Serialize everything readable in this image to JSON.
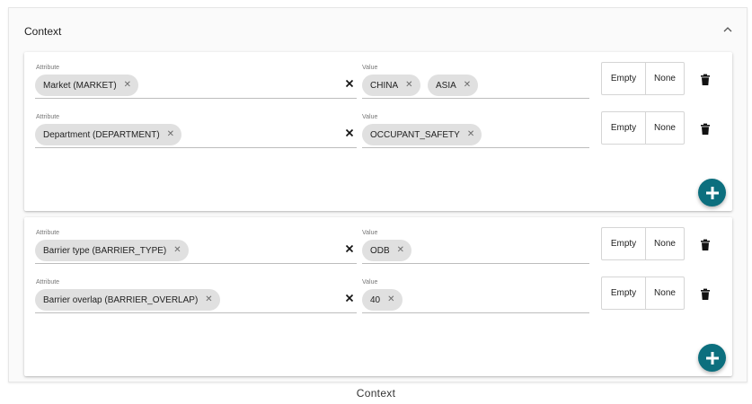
{
  "panel": {
    "title": "Context"
  },
  "groups": [
    {
      "rows": [
        {
          "attribute_label": "Attribute",
          "attribute_chips": [
            "Market (MARKET)"
          ],
          "value_label": "Value",
          "value_chips": [
            "CHINA",
            "ASIA"
          ],
          "toggle": [
            "Empty",
            "None"
          ]
        },
        {
          "attribute_label": "Attribute",
          "attribute_chips": [
            "Department (DEPARTMENT)"
          ],
          "value_label": "Value",
          "value_chips": [
            "OCCUPANT_SAFETY"
          ],
          "toggle": [
            "Empty",
            "None"
          ]
        }
      ]
    },
    {
      "rows": [
        {
          "attribute_label": "Attribute",
          "attribute_chips": [
            "Barrier type (BARRIER_TYPE)"
          ],
          "value_label": "Value",
          "value_chips": [
            "ODB"
          ],
          "toggle": [
            "Empty",
            "None"
          ]
        },
        {
          "attribute_label": "Attribute",
          "attribute_chips": [
            "Barrier overlap (BARRIER_OVERLAP)"
          ],
          "value_label": "Value",
          "value_chips": [
            "40"
          ],
          "toggle": [
            "Empty",
            "None"
          ]
        }
      ]
    }
  ],
  "caption": "Context",
  "colors": {
    "fab": "#0c6f7e",
    "chip": "#e0e0e0"
  },
  "icons": [
    "chevron-up-icon",
    "chip-remove-icon",
    "clear-icon",
    "trash-icon",
    "add-icon"
  ]
}
